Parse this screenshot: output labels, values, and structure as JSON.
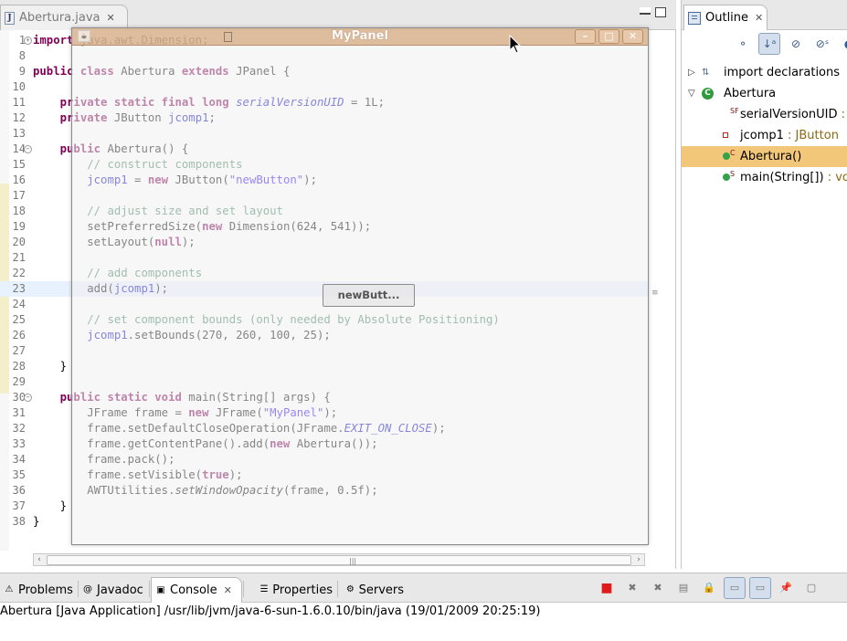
{
  "editor": {
    "tab_label": "Abertura.java",
    "tab_icon": "J",
    "lines": [
      {
        "n": "1",
        "fold": "+",
        "html": "<span class=\"kw\">import</span> java.awt.Dimension;"
      },
      {
        "n": "8",
        "html": ""
      },
      {
        "n": "9",
        "html": "<span class=\"kw\">public class</span> Abertura <span class=\"kw\">extends</span> JPanel {"
      },
      {
        "n": "10",
        "html": ""
      },
      {
        "n": "11",
        "html": "    <span class=\"kw\">private static final long</span> <span class=\"ital\">serialVersionUID</span> = 1L;"
      },
      {
        "n": "12",
        "html": "    <span class=\"kw\">private</span> JButton <span class=\"fld\">jcomp1</span>;"
      },
      {
        "n": "13",
        "html": ""
      },
      {
        "n": "14",
        "fold": "−",
        "html": "    <span class=\"kw\">public</span> Abertura() {"
      },
      {
        "n": "15",
        "html": "        <span class=\"cm\">// construct components</span>"
      },
      {
        "n": "16",
        "html": "        <span class=\"fld\">jcomp1</span> = <span class=\"kw\">new</span> JButton(<span class=\"str\">\"newButton\"</span>);"
      },
      {
        "n": "17",
        "html": ""
      },
      {
        "n": "18",
        "html": "        <span class=\"cm\">// adjust size and set layout</span>"
      },
      {
        "n": "19",
        "html": "        setPreferredSize(<span class=\"kw\">new</span> Dimension(624, 541));"
      },
      {
        "n": "20",
        "html": "        setLayout(<span class=\"kw\">null</span>);"
      },
      {
        "n": "21",
        "html": ""
      },
      {
        "n": "22",
        "html": "        <span class=\"cm\">// add components</span>"
      },
      {
        "n": "23",
        "current": true,
        "html": "        add(<span class=\"fld\">jcomp1</span>);"
      },
      {
        "n": "24",
        "html": ""
      },
      {
        "n": "25",
        "html": "        <span class=\"cm\">// set component bounds (only needed by Absolute Positioning)</span>"
      },
      {
        "n": "26",
        "html": "        <span class=\"fld\">jcomp1</span>.setBounds(270, 260, 100, 25);"
      },
      {
        "n": "27",
        "html": ""
      },
      {
        "n": "28",
        "html": "    }"
      },
      {
        "n": "29",
        "html": ""
      },
      {
        "n": "30",
        "fold": "−",
        "html": "    <span class=\"kw\">public static void</span> main(String[] args) {"
      },
      {
        "n": "31",
        "html": "        JFrame frame = <span class=\"kw\">new</span> JFrame(<span class=\"str\">\"MyPanel\"</span>);"
      },
      {
        "n": "32",
        "html": "        frame.setDefaultCloseOperation(JFrame.<span class=\"ital\">EXIT_ON_CLOSE</span>);"
      },
      {
        "n": "33",
        "html": "        frame.getContentPane().add(<span class=\"kw\">new</span> Abertura());"
      },
      {
        "n": "34",
        "html": "        frame.pack();"
      },
      {
        "n": "35",
        "html": "        frame.setVisible(<span class=\"kw\">true</span>);"
      },
      {
        "n": "36",
        "html": "        AWTUtilities.<span class=\"sit\">setWindowOpacity</span>(frame, 0.5f);"
      },
      {
        "n": "37",
        "html": "    }"
      },
      {
        "n": "38",
        "html": "}"
      }
    ]
  },
  "mypanel": {
    "title": "MyPanel",
    "button_label": "newButt...",
    "min_icon": "–",
    "max_icon": "□",
    "close_icon": "✕"
  },
  "outline": {
    "tab_label": "Outline",
    "items": [
      {
        "label": "import declarations",
        "type": "",
        "indent": 0,
        "twisty": "▷",
        "icon": "import-icon",
        "sup": ""
      },
      {
        "label": "Abertura",
        "type": "",
        "indent": 0,
        "twisty": "▽",
        "icon": "class-icon",
        "sup": ""
      },
      {
        "label": "serialVersionUID",
        "type": " :",
        "indent": 1,
        "twisty": "",
        "icon": "static-final-field-icon",
        "sup": "SF"
      },
      {
        "label": "jcomp1",
        "type": " : JButton",
        "indent": 1,
        "twisty": "",
        "icon": "private-field-icon",
        "sup": ""
      },
      {
        "label": "Abertura()",
        "type": "",
        "indent": 1,
        "twisty": "",
        "icon": "constructor-icon",
        "sup": "C",
        "selected": true
      },
      {
        "label": "main(String[])",
        "type": " : vo",
        "indent": 1,
        "twisty": "",
        "icon": "static-method-icon",
        "sup": "S"
      }
    ]
  },
  "bottom": {
    "tabs": [
      {
        "label": "Problems",
        "icon": "problems-icon",
        "glyph": "⚠"
      },
      {
        "label": "Javadoc",
        "icon": "javadoc-icon",
        "glyph": "@"
      },
      {
        "label": "Console",
        "icon": "console-icon",
        "glyph": "▣",
        "active": true
      },
      {
        "label": "Properties",
        "icon": "properties-icon",
        "glyph": "☰"
      },
      {
        "label": "Servers",
        "icon": "servers-icon",
        "glyph": "⚙"
      }
    ],
    "console_status": "Abertura [Java Application] /usr/lib/jvm/java-6-sun-1.6.0.10/bin/java (19/01/2009 20:25:19)"
  },
  "colors": {
    "keyword": "#7f0055",
    "comment": "#3f7f5f",
    "string": "#2a00ff",
    "field": "#0000c0",
    "selection": "#f3c77a",
    "current_line": "#e8f2fe"
  }
}
